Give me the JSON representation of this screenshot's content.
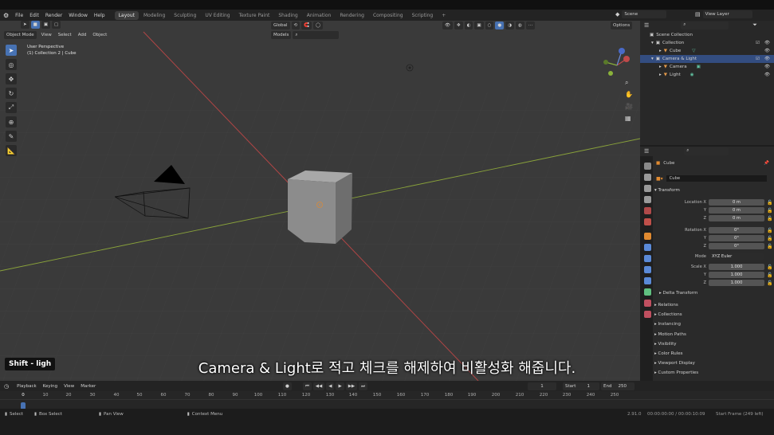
{
  "topbar": {
    "menus": [
      "File",
      "Edit",
      "Render",
      "Window",
      "Help"
    ],
    "workspaces": [
      "Layout",
      "Modeling",
      "Sculpting",
      "UV Editing",
      "Texture Paint",
      "Shading",
      "Animation",
      "Rendering",
      "Compositing",
      "Scripting"
    ],
    "active_workspace": "Layout",
    "add_tab": "+",
    "scene": "Scene",
    "view_layer": "View Layer"
  },
  "viewport_header": {
    "mode": "Object Mode",
    "menus": [
      "View",
      "Select",
      "Add",
      "Object"
    ],
    "transform_orientation": "Global",
    "pivot": "Models",
    "options": "Options"
  },
  "viewport": {
    "perspective": "User Perspective",
    "collection_path": "(1) Collection 2 | Cube"
  },
  "outliner": {
    "items": [
      {
        "label": "Scene Collection",
        "depth": 0
      },
      {
        "label": "Collection",
        "depth": 1
      },
      {
        "label": "Cube",
        "depth": 2
      },
      {
        "label": "Camera & Light",
        "depth": 1,
        "selected": true
      },
      {
        "label": "Camera",
        "depth": 2
      },
      {
        "label": "Light",
        "depth": 2
      }
    ]
  },
  "properties": {
    "object_name": "Cube",
    "datablock": "Cube",
    "transform_title": "Transform",
    "location": {
      "label": "Location X",
      "x": "0 m",
      "y": "0 m",
      "z": "0 m"
    },
    "rotation": {
      "label": "Rotation X",
      "x": "0°",
      "y": "0°",
      "z": "0°"
    },
    "mode_label": "Mode",
    "mode_value": "XYZ Euler",
    "scale": {
      "label": "Scale X",
      "x": "1.000",
      "y": "1.000",
      "z": "1.000"
    },
    "axis_y": "Y",
    "axis_z": "Z",
    "delta": "Delta Transform",
    "panels": [
      "Relations",
      "Collections",
      "Instancing",
      "Motion Paths",
      "Visibility",
      "Color Rules",
      "Viewport Display",
      "Custom Properties"
    ]
  },
  "timeline": {
    "menus": [
      "Playback",
      "Keying",
      "View",
      "Marker"
    ],
    "current_frame": "1",
    "start_label": "Start",
    "start": "1",
    "end_label": "End",
    "end": "250",
    "ticks": [
      "0",
      "10",
      "20",
      "30",
      "40",
      "50",
      "60",
      "70",
      "80",
      "90",
      "100",
      "110",
      "120",
      "130",
      "140",
      "150",
      "160",
      "170",
      "180",
      "190",
      "200",
      "210",
      "220",
      "230",
      "240",
      "250"
    ]
  },
  "statusbar": {
    "select": "Select",
    "box_select": "Box Select",
    "pan_view": "Pan View",
    "context_menu": "Context Menu",
    "version": "2.91.0",
    "time": "00:00:00:00 / 00:00:10:09",
    "frame_info": "Start Frame (249 left)"
  },
  "overlay": {
    "keycast": "Shift - ligh",
    "subtitle": "Camera & Light로 적고 체크를 해제하여 비활성화 해줍니다."
  },
  "colors": {
    "accent": "#4772b3",
    "selection": "#334d80",
    "x_axis": "#b04545",
    "y_axis": "#8aa33a"
  }
}
